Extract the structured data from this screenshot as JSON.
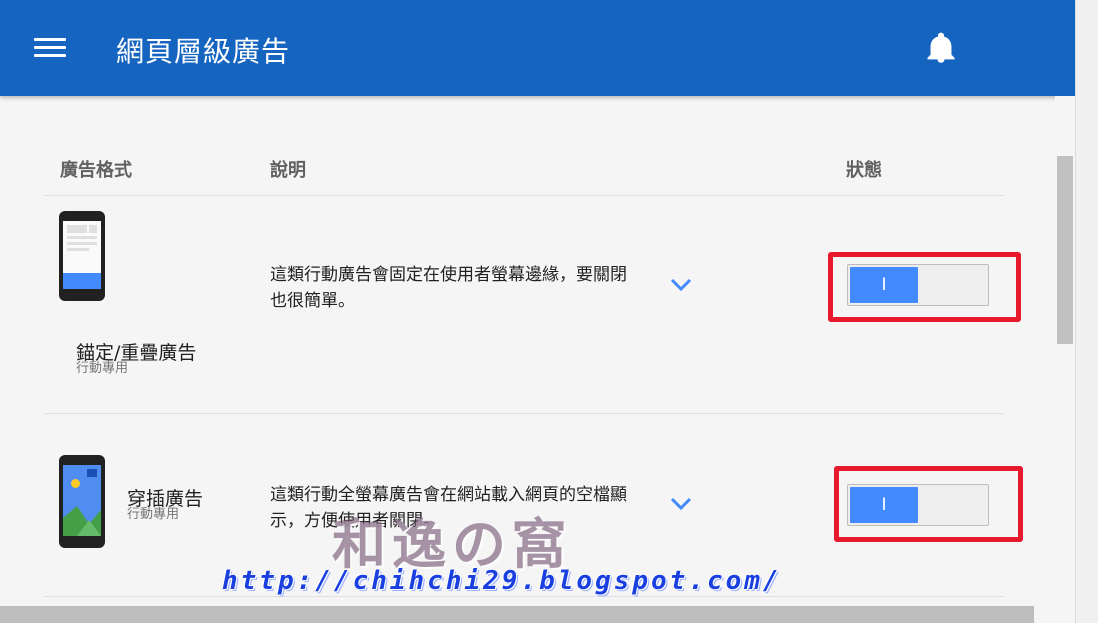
{
  "header": {
    "title": "網頁層級廣告",
    "menu_icon": "menu-icon",
    "notifications_icon": "bell-icon"
  },
  "table": {
    "columns": [
      "廣告格式",
      "說明",
      "狀態"
    ]
  },
  "rows": [
    {
      "format_name": "錨定/重疊廣告",
      "format_sub": "行動專用",
      "description": "這類行動廣告會固定在使用者螢幕邊緣，要關閉也很簡單。",
      "toggle_label": "I",
      "status": "on"
    },
    {
      "format_name": "穿插廣告",
      "format_sub": "行動專用",
      "description": "這類行動全螢幕廣告會在網站載入網頁的空檔顯示，方便使用者關閉。",
      "toggle_label": "I",
      "status": "on"
    }
  ],
  "watermark": {
    "logo_text": "和逸の窩",
    "url": "http://chihchi29.blogspot.com/"
  },
  "colors": {
    "app_bar": "#1565c0",
    "toggle_on": "#448aff",
    "highlight": "#e8192c"
  }
}
